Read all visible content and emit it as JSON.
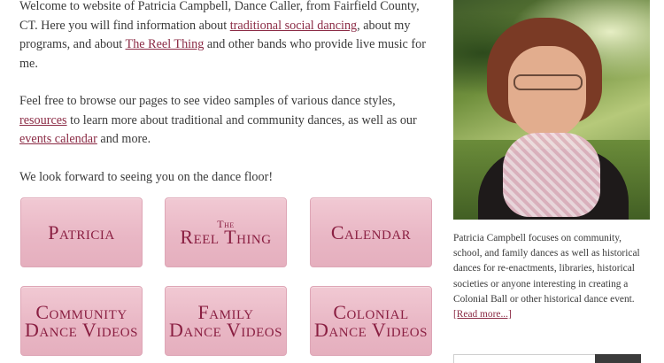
{
  "intro": {
    "text1": "Welcome to website of Patricia Campbell, Dance Caller, from Fairfield County, CT. Here you will find information about ",
    "link1": "traditional social dancing",
    "text2": ", about my programs, and about ",
    "link2": "The Reel Thing",
    "text3": " and other bands who provide live music for me."
  },
  "browse": {
    "text1": "Feel free to browse our pages to see video samples of various dance styles, ",
    "link1": "resources",
    "text2": " to learn more about traditional and community dances, as well as our ",
    "link2": "events calendar",
    "text3": " and more."
  },
  "closing": "We look forward to seeing you on the dance floor!",
  "tiles": {
    "patricia": "Patricia",
    "reel_small": "The",
    "reel": "Reel Thing",
    "calendar": "Calendar",
    "community_1": "Community",
    "community_2": "Dance Videos",
    "family_1": "Family",
    "family_2": "Dance Videos",
    "colonial_1": "Colonial",
    "colonial_2": "Dance Videos"
  },
  "sidebar": {
    "caption": "Patricia Campbell focuses on community, school, and family dances as well as historical dances for re-enactments, libraries, historical societies or anyone interesting in creating a Colonial Ball or other historical dance event. ",
    "read_more": "[Read more...]"
  },
  "colors": {
    "link": "#8b2b45",
    "tile_bg": "#ebbcc9",
    "tile_text": "#8a1f42"
  }
}
